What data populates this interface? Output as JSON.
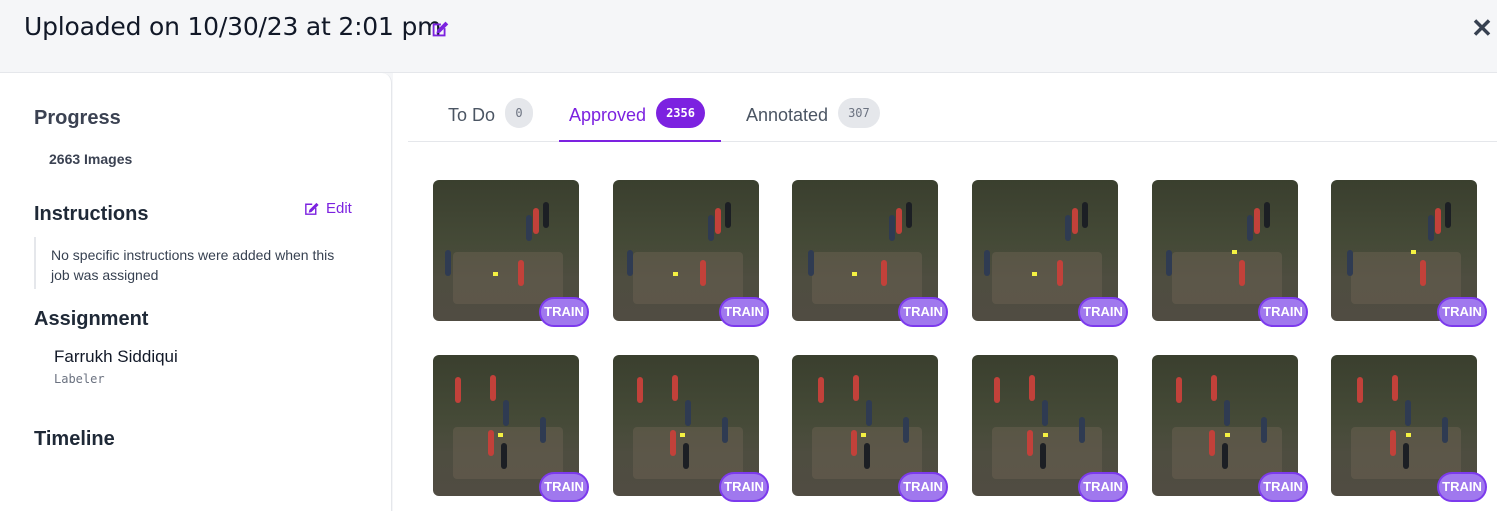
{
  "header": {
    "title": "Uploaded on 10/30/23 at 2:01 pm",
    "edit_icon": "edit-icon",
    "close_icon": "close-icon",
    "close_glyph": "✕"
  },
  "sidebar": {
    "progress_heading": "Progress",
    "images_count": "2663 Images",
    "instructions_heading": "Instructions",
    "edit_label": "Edit",
    "instructions_text": "No specific instructions were added when this job was assigned",
    "assignment_heading": "Assignment",
    "assignee_name": "Farrukh Siddiqui",
    "assignee_role": "Labeler",
    "timeline_heading": "Timeline"
  },
  "tabs": [
    {
      "label": "To Do",
      "count": "0",
      "active": false
    },
    {
      "label": "Approved",
      "count": "2356",
      "active": true
    },
    {
      "label": "Annotated",
      "count": "307",
      "active": false
    }
  ],
  "thumbnails": {
    "badge_label": "TRAIN",
    "rows": [
      [
        "TRAIN",
        "TRAIN",
        "TRAIN",
        "TRAIN",
        "TRAIN",
        "TRAIN"
      ],
      [
        "TRAIN",
        "TRAIN",
        "TRAIN",
        "TRAIN",
        "TRAIN",
        "TRAIN"
      ]
    ]
  },
  "colors": {
    "accent": "#7c22e0",
    "badge_fill": "#a078ee",
    "badge_border": "#7c3aed"
  }
}
